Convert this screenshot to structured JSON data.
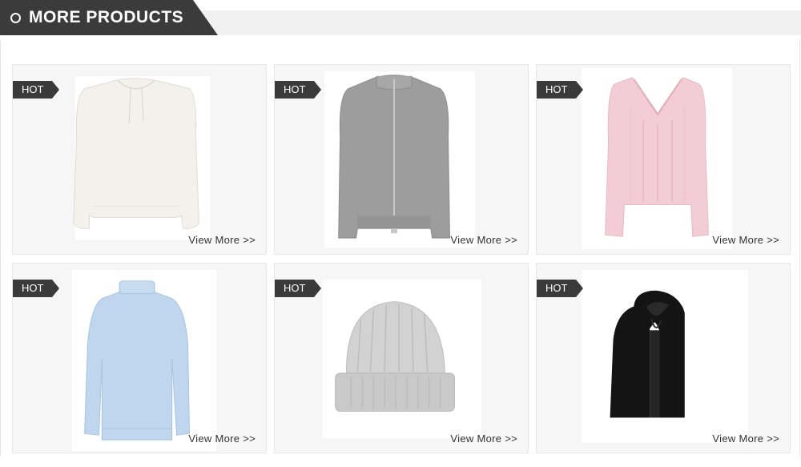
{
  "section": {
    "title": "MORE PRODUCTS",
    "accent_color": "#3b3b3b"
  },
  "products": [
    {
      "badge": "HOT",
      "link_label": "View More >>",
      "icon": "white-hooded-sweater-icon"
    },
    {
      "badge": "HOT",
      "link_label": "View More >>",
      "icon": "grey-zip-cardigan-icon"
    },
    {
      "badge": "HOT",
      "link_label": "View More >>",
      "icon": "pink-vneck-cable-sweater-icon"
    },
    {
      "badge": "HOT",
      "link_label": "View More >>",
      "icon": "light-blue-turtleneck-icon"
    },
    {
      "badge": "HOT",
      "link_label": "View More >>",
      "icon": "grey-knit-beanie-icon"
    },
    {
      "badge": "HOT",
      "link_label": "View More >>",
      "icon": "black-scarf-icon"
    }
  ]
}
